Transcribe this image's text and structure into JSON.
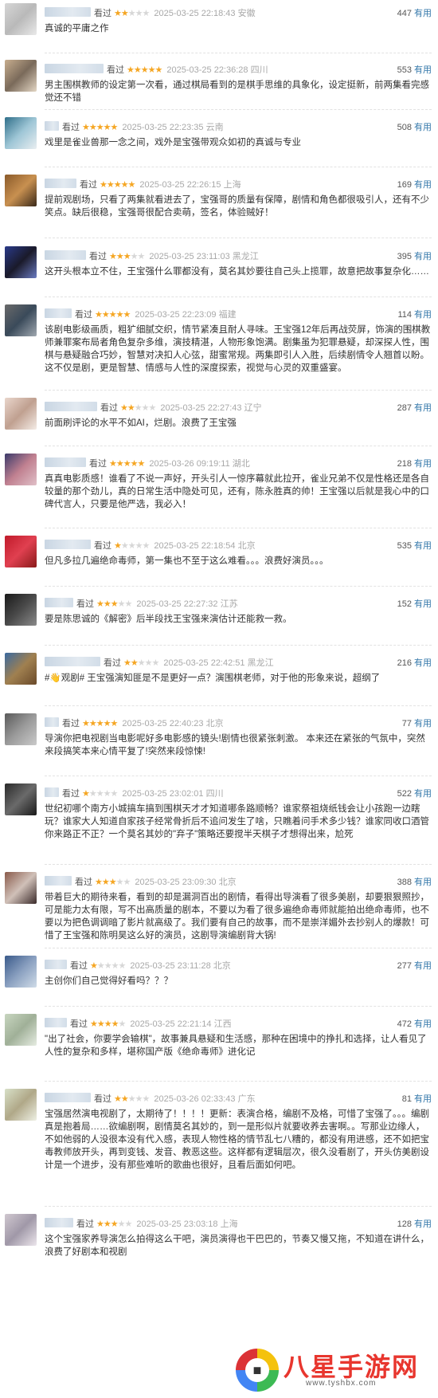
{
  "reviews": [
    {
      "w": 58,
      "rating": 2,
      "meta": "2025-03-25 22:18:43 安徽",
      "votes": "447",
      "text": "真诚的平庸之作",
      "av": [
        "#d6d6d6",
        "#b9b9b9",
        "#e9e9e9"
      ]
    },
    {
      "w": 74,
      "rating": 5,
      "meta": "2025-03-25 22:36:28 四川",
      "votes": "553",
      "text": "男主围棋教师的设定第一次看，通过棋局看到的是棋手思维的具象化，设定挺新，前两集看完感觉还不错",
      "av": [
        "#c7ad8e",
        "#7a6a5a",
        "#e3d6c4"
      ]
    },
    {
      "w": 18,
      "rating": 5,
      "meta": "2025-03-25 22:23:35 云南",
      "votes": "508",
      "text": "戏里是雀业兽那一念之间，戏外是宝强带观众如初的真诚与专业",
      "av": [
        "#2f6f8a",
        "#9ec6d6",
        "#e9eef1"
      ]
    },
    {
      "w": 40,
      "rating": 5,
      "meta": "2025-03-25 22:26:15 上海",
      "votes": "169",
      "text": "提前观剧场，只看了两集就看进去了，宝强哥的质量有保障，剧情和角色都很吸引人，还有不少笑点。缺后很稳，宝强哥很配合卖萌，签名，体验贼好！",
      "av": [
        "#8a5a2a",
        "#c89050",
        "#3a2a1a"
      ]
    },
    {
      "w": 52,
      "rating": 3,
      "meta": "2025-03-25 23:11:03 黑龙江",
      "votes": "395",
      "text": "这开头根本立不住，王宝强什么罪都没有，莫名其妙要往自己头上揽罪，故意把故事复杂化……",
      "av": [
        "#2a3a8a",
        "#1a1a2a",
        "#6a7ac0"
      ]
    },
    {
      "w": 34,
      "rating": 5,
      "meta": "2025-03-25 22:23:09 福建",
      "votes": "114",
      "text": "该剧电影级画质，粗犷细腻交织，情节紧凑且耐人寻味。王宝强12年后再战荧屏，饰演的围棋教师兼罪案布局者角色复杂多维，演技精湛，人物形象饱满。剧集虽为犯罪悬疑，却深探人性，围棋与悬疑融合巧妙，智慧对决扣人心弦，甜蜜常规。两集即引人入胜，后续剧情令人翘首以盼。这不仅是剧，更是智慧、情感与人性的深度探索，视觉与心灵的双重盛宴。",
      "av": [
        "#6a6a6a",
        "#3a4a5a",
        "#a0a8b0"
      ]
    },
    {
      "w": 66,
      "rating": 2,
      "meta": "2025-03-25 22:27:43 辽宁",
      "votes": "287",
      "text": "前面刷评论的水平不如AI，烂剧。浪费了王宝强",
      "av": [
        "#e9d6cc",
        "#c0a090",
        "#f4ece6"
      ]
    },
    {
      "w": 52,
      "rating": 5,
      "meta": "2025-03-26 09:19:11 湖北",
      "votes": "218",
      "text": "真真电影质感！谁看了不说一声好，开头引人一惊序幕就此拉开，雀业兄弟不仅是性格还是各自较量的那个劲儿，真的日常生活中隐处可见，还有，陈永胜真的帅！王宝强以后就是我心中的口碑代言人，只要是他严选，我必入！",
      "av": [
        "#3a3a6a",
        "#c08090",
        "#e0c0c8"
      ]
    },
    {
      "w": 58,
      "rating": 1,
      "meta": "2025-03-25 22:18:54 北京",
      "votes": "535",
      "text": "但凡多拉几遍绝命毒师，第一集也不至于这么难看。。。浪费好演员。。。",
      "av": [
        "#c01a2a",
        "#e04050",
        "#8a1a1a"
      ]
    },
    {
      "w": 36,
      "rating": 3,
      "meta": "2025-03-25 22:27:32 江苏",
      "votes": "152",
      "text": "要是陈思诚的《解密》后半段找王宝强来演估计还能救一救。",
      "av": [
        "#1a1a1a",
        "#4a4a4a",
        "#8a8a8a"
      ]
    },
    {
      "w": 70,
      "rating": 2,
      "meta": "2025-03-25 22:42:51 黑龙江",
      "votes": "216",
      "text": "#👋观剧# 王宝强演知匪是不是更好一点？演围棋老师，对于他的形象来说，超纲了",
      "av": [
        "#3a6aa0",
        "#a08050",
        "#6a4a2a"
      ]
    },
    {
      "w": 18,
      "rating": 5,
      "meta": "2025-03-25 22:40:23 北京",
      "votes": "77",
      "text": "导演你把电视剧当电影呢好多电影感的镜头!剧情也很紧张刺激。 本来还在紧张的气氛中，突然来段搞笑本来心情平复了!突然来段惊悚!",
      "av": [
        "#5a5a5a",
        "#9a9a9a",
        "#cacaca"
      ]
    },
    {
      "w": 18,
      "rating": 1,
      "meta": "2025-03-25 23:02:01 四川",
      "votes": "522",
      "text": "世纪初哪个南方小城搞车搞到围棋天才才知道哪条路顺畅？谁家祭祖烧纸钱会让小孩跑一边瞎玩？谁家大人知道自家孩子经常骨折后不追问发生了啥，只瞧着问手术多少钱？谁家同收口酒管你来路正不正？一个莫名其妙的\"弃子\"策略还要搅半天棋子才想得出来，尬死",
      "av": [
        "#2a2a2a",
        "#6a6a6a",
        "#1a1a1a"
      ]
    },
    {
      "w": 34,
      "rating": 3,
      "meta": "2025-03-25 23:09:30 北京",
      "votes": "388",
      "text": "带着巨大的期待来看，看到的却是漏洞百出的剧情，看得出导演看了很多美剧，却要狠狠照抄，可是能力太有限，写不出高质量的剧本，不要以为看了很多遍绝命毒师就能拍出绝命毒师，也不要以为把色调调暗了影片就高级了。我们要有自己的故事，而不是崇洋媚外去抄别人的爆款！可惜了王宝强和陈明昊这么好的演员，这剧导演编剧背大锅!",
      "av": [
        "#8a5a4a",
        "#d0c0b8",
        "#3a2a2a"
      ]
    },
    {
      "w": 28,
      "rating": 1,
      "meta": "2025-03-25 23:11:28 北京",
      "votes": "277",
      "text": "主创你们自己觉得好看吗？？？",
      "av": [
        "#3a5a8a",
        "#8aa0c0",
        "#d0dce8"
      ]
    },
    {
      "w": 28,
      "rating": 4,
      "meta": "2025-03-25 22:21:14 江西",
      "votes": "472",
      "text": "\"出了社会，你要学会输棋\"，故事兼具悬疑和生活感，那种在困境中的挣扎和选择，让人看见了人性的复杂和多样，堪称国产版《绝命毒师》进化记",
      "av": [
        "#c8d6c0",
        "#a0b098",
        "#e6ece2"
      ]
    },
    {
      "w": 58,
      "rating": 2,
      "meta": "2025-03-26 02:33:43 广东",
      "votes": "81",
      "text": "宝强居然演电视剧了，太期待了！！！！更新：表演合格，编剧不及格，可惜了宝强了。。。编剧真是抱着局……欲编剧啊，剧情莫名其妙的，到一是形似片就要收养去害啊。。写那业边缘人，不如他弱的人没很本没有代入感，表现人物性格的情节乱七八糟的，都没有用进感，还不如把宝毒教师放开头，再到变钱、发音、教恶这些。这样都有逻辑层次，很久没看剧了，开头仿美剧设计是一个进步，没有那些难听的歌曲也很好，且看后面如何吧。",
      "av": [
        "#d8e0c8",
        "#b0a888",
        "#eef0e4"
      ]
    },
    {
      "w": 36,
      "rating": 3,
      "meta": "2025-03-25 23:03:18 上海",
      "votes": "128",
      "text": "这个宝强家养导演怎么拍得这么干吧，演员演得也干巴巴的，节奏又慢又拖，不知道在讲什么，浪费了好剧本和视剧",
      "av": [
        "#d0c8d0",
        "#a098a8",
        "#ece6ec"
      ]
    }
  ],
  "labels": {
    "watched": "看过",
    "useful": "有用"
  },
  "watermark": {
    "brand": "八星手游网",
    "url": "www.tyshbx.com"
  }
}
